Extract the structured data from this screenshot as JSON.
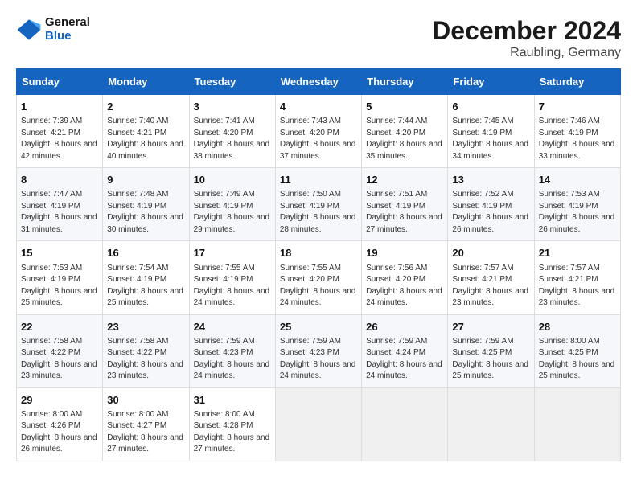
{
  "header": {
    "logo_line1": "General",
    "logo_line2": "Blue",
    "title": "December 2024",
    "subtitle": "Raubling, Germany"
  },
  "weekdays": [
    "Sunday",
    "Monday",
    "Tuesday",
    "Wednesday",
    "Thursday",
    "Friday",
    "Saturday"
  ],
  "weeks": [
    [
      {
        "day": "1",
        "sunrise": "Sunrise: 7:39 AM",
        "sunset": "Sunset: 4:21 PM",
        "daylight": "Daylight: 8 hours and 42 minutes."
      },
      {
        "day": "2",
        "sunrise": "Sunrise: 7:40 AM",
        "sunset": "Sunset: 4:21 PM",
        "daylight": "Daylight: 8 hours and 40 minutes."
      },
      {
        "day": "3",
        "sunrise": "Sunrise: 7:41 AM",
        "sunset": "Sunset: 4:20 PM",
        "daylight": "Daylight: 8 hours and 38 minutes."
      },
      {
        "day": "4",
        "sunrise": "Sunrise: 7:43 AM",
        "sunset": "Sunset: 4:20 PM",
        "daylight": "Daylight: 8 hours and 37 minutes."
      },
      {
        "day": "5",
        "sunrise": "Sunrise: 7:44 AM",
        "sunset": "Sunset: 4:20 PM",
        "daylight": "Daylight: 8 hours and 35 minutes."
      },
      {
        "day": "6",
        "sunrise": "Sunrise: 7:45 AM",
        "sunset": "Sunset: 4:19 PM",
        "daylight": "Daylight: 8 hours and 34 minutes."
      },
      {
        "day": "7",
        "sunrise": "Sunrise: 7:46 AM",
        "sunset": "Sunset: 4:19 PM",
        "daylight": "Daylight: 8 hours and 33 minutes."
      }
    ],
    [
      {
        "day": "8",
        "sunrise": "Sunrise: 7:47 AM",
        "sunset": "Sunset: 4:19 PM",
        "daylight": "Daylight: 8 hours and 31 minutes."
      },
      {
        "day": "9",
        "sunrise": "Sunrise: 7:48 AM",
        "sunset": "Sunset: 4:19 PM",
        "daylight": "Daylight: 8 hours and 30 minutes."
      },
      {
        "day": "10",
        "sunrise": "Sunrise: 7:49 AM",
        "sunset": "Sunset: 4:19 PM",
        "daylight": "Daylight: 8 hours and 29 minutes."
      },
      {
        "day": "11",
        "sunrise": "Sunrise: 7:50 AM",
        "sunset": "Sunset: 4:19 PM",
        "daylight": "Daylight: 8 hours and 28 minutes."
      },
      {
        "day": "12",
        "sunrise": "Sunrise: 7:51 AM",
        "sunset": "Sunset: 4:19 PM",
        "daylight": "Daylight: 8 hours and 27 minutes."
      },
      {
        "day": "13",
        "sunrise": "Sunrise: 7:52 AM",
        "sunset": "Sunset: 4:19 PM",
        "daylight": "Daylight: 8 hours and 26 minutes."
      },
      {
        "day": "14",
        "sunrise": "Sunrise: 7:53 AM",
        "sunset": "Sunset: 4:19 PM",
        "daylight": "Daylight: 8 hours and 26 minutes."
      }
    ],
    [
      {
        "day": "15",
        "sunrise": "Sunrise: 7:53 AM",
        "sunset": "Sunset: 4:19 PM",
        "daylight": "Daylight: 8 hours and 25 minutes."
      },
      {
        "day": "16",
        "sunrise": "Sunrise: 7:54 AM",
        "sunset": "Sunset: 4:19 PM",
        "daylight": "Daylight: 8 hours and 25 minutes."
      },
      {
        "day": "17",
        "sunrise": "Sunrise: 7:55 AM",
        "sunset": "Sunset: 4:19 PM",
        "daylight": "Daylight: 8 hours and 24 minutes."
      },
      {
        "day": "18",
        "sunrise": "Sunrise: 7:55 AM",
        "sunset": "Sunset: 4:20 PM",
        "daylight": "Daylight: 8 hours and 24 minutes."
      },
      {
        "day": "19",
        "sunrise": "Sunrise: 7:56 AM",
        "sunset": "Sunset: 4:20 PM",
        "daylight": "Daylight: 8 hours and 24 minutes."
      },
      {
        "day": "20",
        "sunrise": "Sunrise: 7:57 AM",
        "sunset": "Sunset: 4:21 PM",
        "daylight": "Daylight: 8 hours and 23 minutes."
      },
      {
        "day": "21",
        "sunrise": "Sunrise: 7:57 AM",
        "sunset": "Sunset: 4:21 PM",
        "daylight": "Daylight: 8 hours and 23 minutes."
      }
    ],
    [
      {
        "day": "22",
        "sunrise": "Sunrise: 7:58 AM",
        "sunset": "Sunset: 4:22 PM",
        "daylight": "Daylight: 8 hours and 23 minutes."
      },
      {
        "day": "23",
        "sunrise": "Sunrise: 7:58 AM",
        "sunset": "Sunset: 4:22 PM",
        "daylight": "Daylight: 8 hours and 23 minutes."
      },
      {
        "day": "24",
        "sunrise": "Sunrise: 7:59 AM",
        "sunset": "Sunset: 4:23 PM",
        "daylight": "Daylight: 8 hours and 24 minutes."
      },
      {
        "day": "25",
        "sunrise": "Sunrise: 7:59 AM",
        "sunset": "Sunset: 4:23 PM",
        "daylight": "Daylight: 8 hours and 24 minutes."
      },
      {
        "day": "26",
        "sunrise": "Sunrise: 7:59 AM",
        "sunset": "Sunset: 4:24 PM",
        "daylight": "Daylight: 8 hours and 24 minutes."
      },
      {
        "day": "27",
        "sunrise": "Sunrise: 7:59 AM",
        "sunset": "Sunset: 4:25 PM",
        "daylight": "Daylight: 8 hours and 25 minutes."
      },
      {
        "day": "28",
        "sunrise": "Sunrise: 8:00 AM",
        "sunset": "Sunset: 4:25 PM",
        "daylight": "Daylight: 8 hours and 25 minutes."
      }
    ],
    [
      {
        "day": "29",
        "sunrise": "Sunrise: 8:00 AM",
        "sunset": "Sunset: 4:26 PM",
        "daylight": "Daylight: 8 hours and 26 minutes."
      },
      {
        "day": "30",
        "sunrise": "Sunrise: 8:00 AM",
        "sunset": "Sunset: 4:27 PM",
        "daylight": "Daylight: 8 hours and 27 minutes."
      },
      {
        "day": "31",
        "sunrise": "Sunrise: 8:00 AM",
        "sunset": "Sunset: 4:28 PM",
        "daylight": "Daylight: 8 hours and 27 minutes."
      },
      null,
      null,
      null,
      null
    ]
  ]
}
